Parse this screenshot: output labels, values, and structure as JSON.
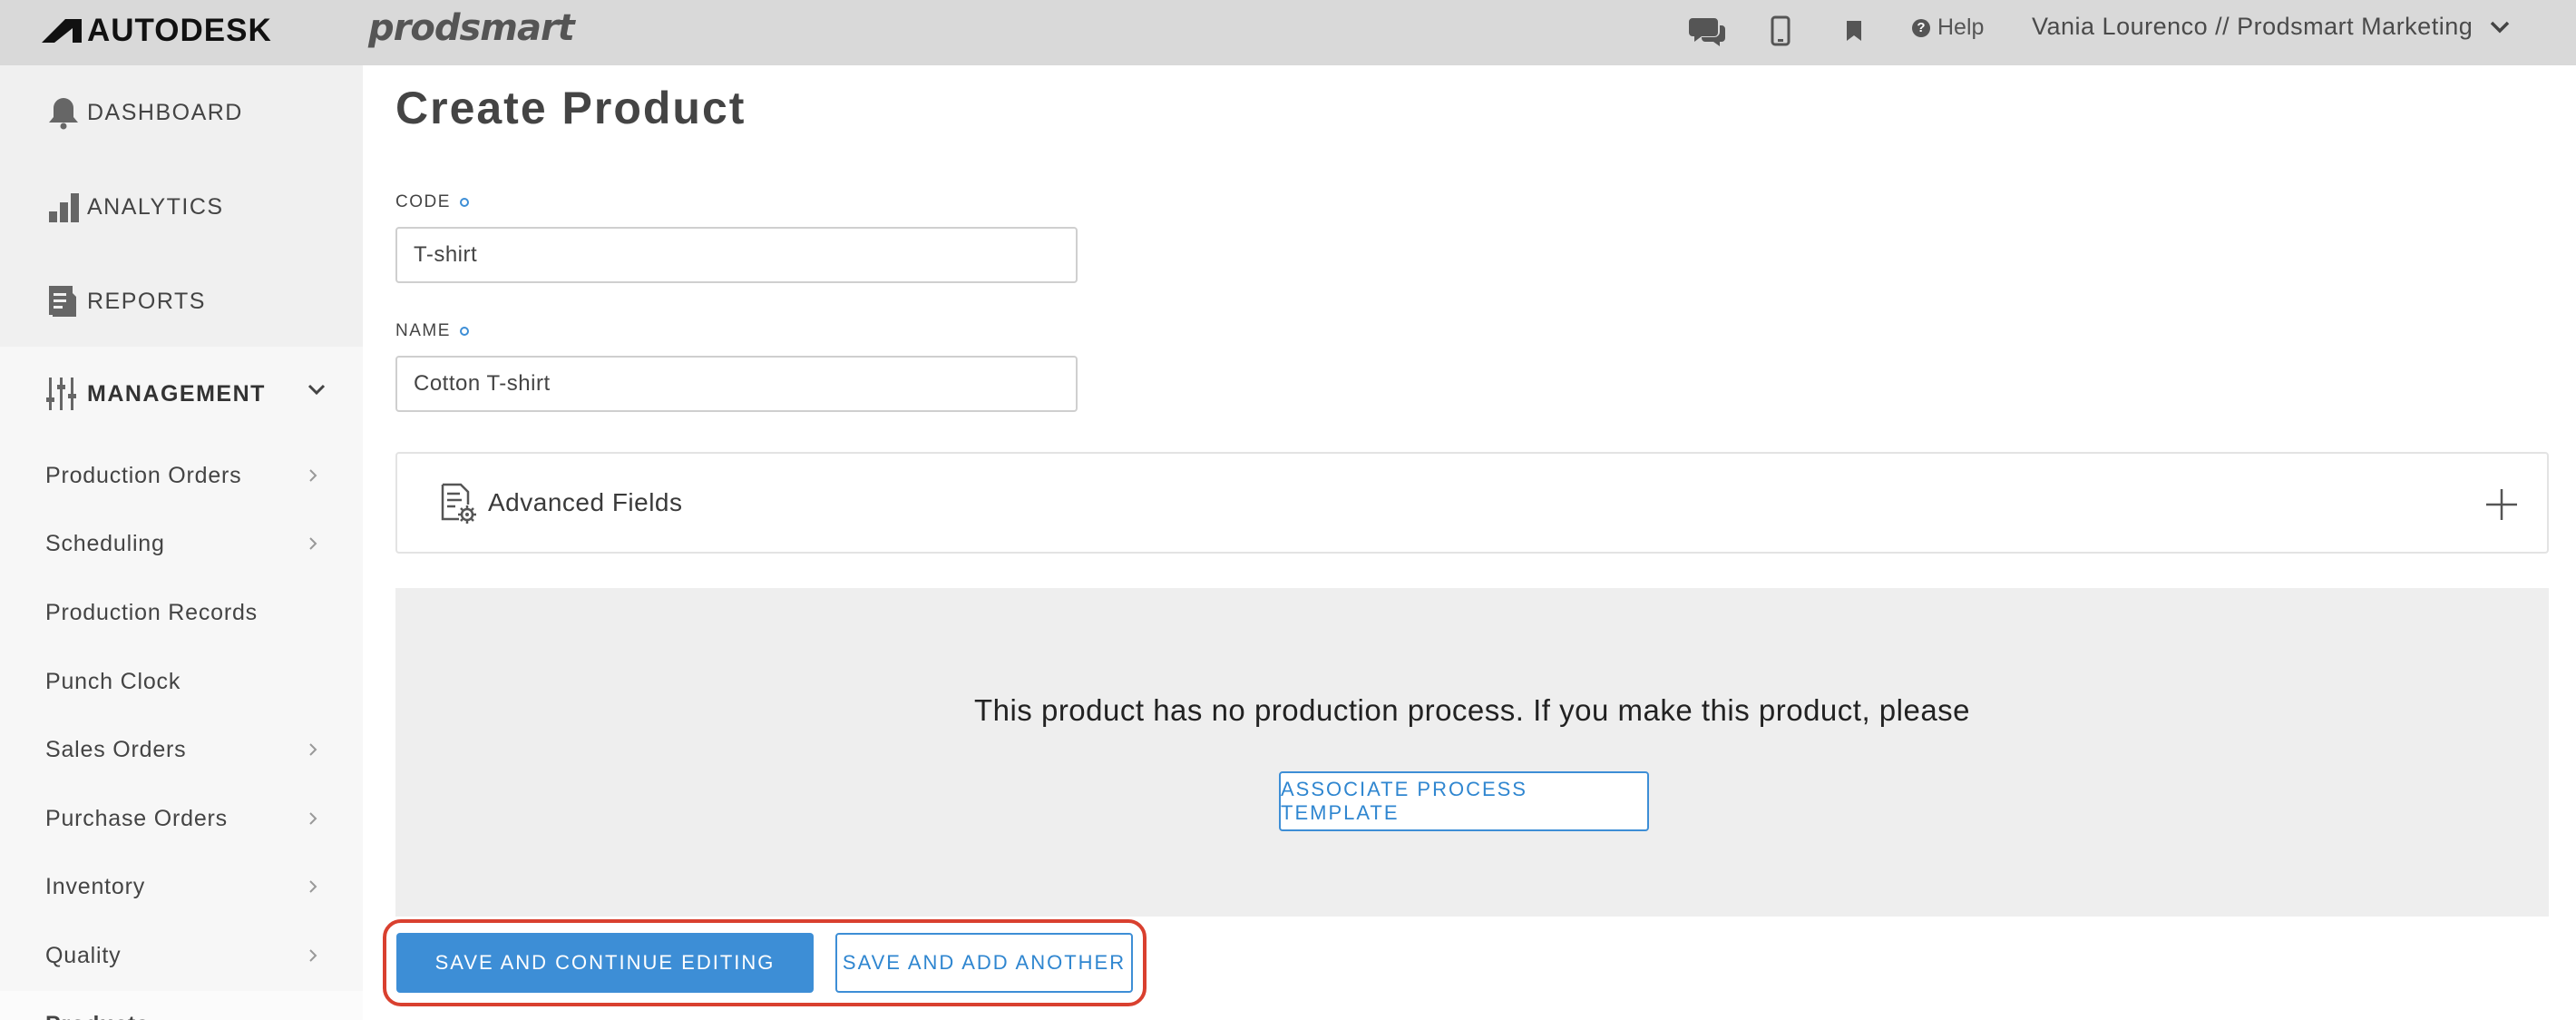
{
  "topbar": {
    "brand_autodesk": "AUTODESK",
    "brand_prodsmart": "prodsmart",
    "help_label": "Help",
    "user_label": "Vania Lourenco // Prodsmart Marketing"
  },
  "sidebar": {
    "main_items": [
      "DASHBOARD",
      "ANALYTICS",
      "REPORTS"
    ],
    "management_label": "MANAGEMENT",
    "sub_items": [
      "Production Orders",
      "Scheduling",
      "Production Records",
      "Punch Clock",
      "Sales Orders",
      "Purchase Orders",
      "Inventory",
      "Quality",
      "Products"
    ]
  },
  "main": {
    "title": "Create Product",
    "code_label": "CODE",
    "code_value": "T-shirt",
    "name_label": "NAME",
    "name_value": "Cotton T-shirt",
    "advanced_label": "Advanced Fields",
    "process_message": "This product has no production process. If you make this product, please",
    "associate_button": "ASSOCIATE PROCESS TEMPLATE",
    "save_continue_button": "SAVE AND CONTINUE EDITING",
    "save_add_button": "SAVE AND ADD ANOTHER"
  },
  "colors": {
    "accent": "#3d8ed6",
    "highlight": "#d9402f",
    "topbar_bg": "#d9d9d9",
    "sidebar_bg": "#f0f0f0"
  },
  "icons": {
    "topbar": [
      "chat-icon",
      "mobile-icon",
      "bookmark-icon",
      "help-icon",
      "chevron-down-icon"
    ],
    "sidebar": [
      "bell-icon",
      "bar-chart-icon",
      "report-icon",
      "sliders-icon"
    ]
  }
}
